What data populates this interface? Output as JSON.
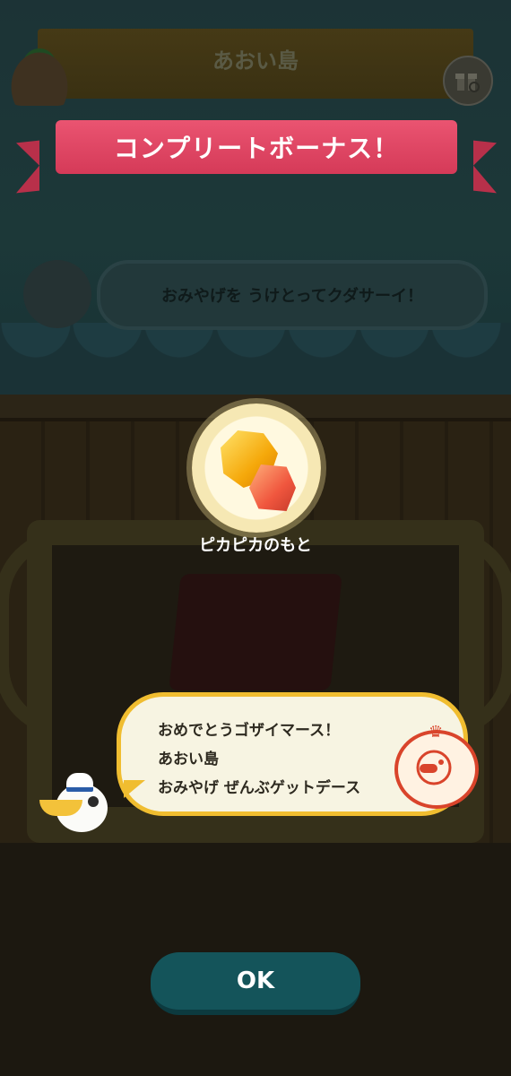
{
  "header": {
    "island_title": "あおい島"
  },
  "banner": {
    "title": "コンプリートボーナス！"
  },
  "dim_dialog": {
    "text": "おみやげを うけとってクダサーイ！"
  },
  "reward": {
    "name": "ピカピカのもと"
  },
  "message": {
    "line1": "おめでとうゴザイマース！",
    "line2": "あおい島",
    "line3": "おみやげ ぜんぶゲットデース"
  },
  "actions": {
    "ok_label": "OK"
  },
  "colors": {
    "ribbon": "#e24a67",
    "ok_button": "#14545a",
    "bubble_border": "#f0bd30"
  },
  "icons": [
    "island-icon",
    "gift-search-icon",
    "gem-icon",
    "pelican-icon",
    "complete-stamp-icon"
  ]
}
